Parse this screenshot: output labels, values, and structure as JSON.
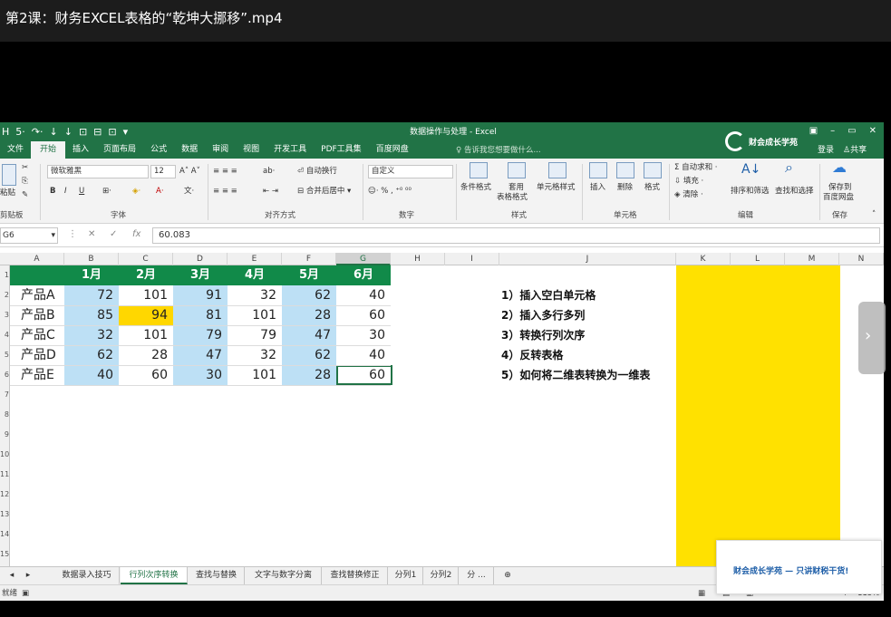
{
  "video": {
    "title": "第2课：财务EXCEL表格的“乾坤大挪移”.mp4",
    "overlay": "财会成长学苑 — 只讲财税干货!",
    "next_icon": "chevron-right-icon"
  },
  "excel": {
    "window_title": "数据操作与处理 - Excel",
    "qat": [
      "H",
      "5·",
      "↷·",
      "↓",
      "↓",
      "⊡",
      "⊟",
      "⊡",
      "▾"
    ],
    "win_controls": [
      "▣",
      "–",
      "▭",
      "✕"
    ],
    "menu": [
      "文件",
      "开始",
      "插入",
      "页面布局",
      "公式",
      "数据",
      "审阅",
      "视图",
      "开发工具",
      "PDF工具集",
      "百度网盘"
    ],
    "active_menu": "开始",
    "tell_me": "告诉我您想要做什么...",
    "brand": "财会成长学苑",
    "login": "登录",
    "share": "共享",
    "ribbon": {
      "paste": "粘贴",
      "clipboard": "剪贴板",
      "font_name": "微软雅黑",
      "font_size": "12",
      "font_group": "字体",
      "wrap": "自动换行",
      "merge": "合并后居中",
      "align_group": "对齐方式",
      "number_format": "自定义",
      "number_group": "数字",
      "cond_format": "条件格式",
      "table_format_1": "套用",
      "table_format_2": "表格格式",
      "cell_style": "单元格样式",
      "style_group": "样式",
      "insert": "插入",
      "delete": "删除",
      "format": "格式",
      "cells_group": "单元格",
      "autosum": "自动求和",
      "fill": "填充",
      "clear": "清除",
      "sort_filter": "排序和筛选",
      "find_select": "查找和选择",
      "edit_group": "编辑",
      "save_to_1": "保存到",
      "save_to_2": "百度网盘",
      "save_group": "保存"
    },
    "name_box": "G6",
    "formula_value": "60.083",
    "columns": [
      "A",
      "B",
      "C",
      "D",
      "E",
      "F",
      "G",
      "H",
      "I",
      "J",
      "K",
      "L",
      "M",
      "N"
    ],
    "rows": [
      "1",
      "2",
      "3",
      "4",
      "5",
      "6",
      "7",
      "8",
      "9",
      "10",
      "11",
      "12",
      "13",
      "14",
      "15"
    ],
    "table": {
      "headers": [
        "1月",
        "2月",
        "3月",
        "4月",
        "5月",
        "6月"
      ],
      "rows": [
        {
          "name": "产品A",
          "values": [
            "72",
            "101",
            "91",
            "32",
            "62",
            "40"
          ]
        },
        {
          "name": "产品B",
          "values": [
            "85",
            "94",
            "81",
            "101",
            "28",
            "60"
          ]
        },
        {
          "name": "产品C",
          "values": [
            "32",
            "101",
            "79",
            "79",
            "47",
            "30"
          ]
        },
        {
          "name": "产品D",
          "values": [
            "62",
            "28",
            "47",
            "32",
            "62",
            "40"
          ]
        },
        {
          "name": "产品E",
          "values": [
            "40",
            "60",
            "30",
            "101",
            "28",
            "60"
          ]
        }
      ]
    },
    "list": [
      "1）插入空白单元格",
      "2）插入多行多列",
      "3）转换行列次序",
      "4）反转表格",
      "5）如何将二维表转换为一维表"
    ],
    "sheet_tabs": [
      "数据录入技巧",
      "行列次序转换",
      "查找与替换",
      "文字与数字分离",
      "查找替换修正",
      "分列1",
      "分列2",
      "分 ..."
    ],
    "active_tab": "行列次序转换",
    "status": {
      "ready": "就绪",
      "zoom": "115%"
    },
    "colors": {
      "green": "#217346",
      "header_green": "#118a49",
      "blue": "#bde0f5",
      "yellow": "#ffd700"
    }
  }
}
